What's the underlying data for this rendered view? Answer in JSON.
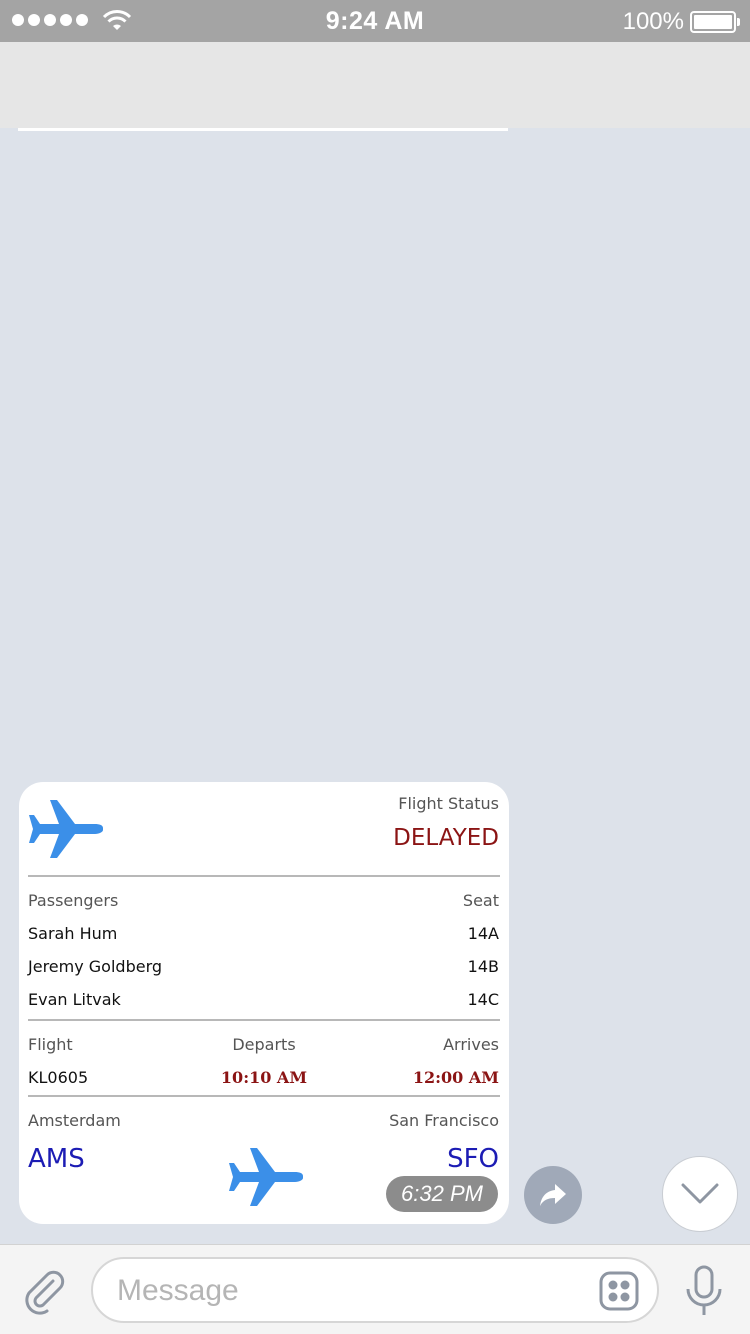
{
  "status_bar": {
    "time": "9:24 AM",
    "battery_percent": "100%",
    "battery_level": 1.0,
    "signal_bars": 5,
    "icons": [
      "signal-dots-icon",
      "wifi-icon",
      "battery-icon"
    ]
  },
  "card": {
    "status_label": "Flight Status",
    "status_value": "DELAYED",
    "passengers_header": "Passengers",
    "seat_header": "Seat",
    "passengers": [
      {
        "name": "Sarah Hum",
        "seat": "14A"
      },
      {
        "name": "Jeremy Goldberg",
        "seat": "14B"
      },
      {
        "name": "Evan Litvak",
        "seat": "14C"
      }
    ],
    "flight_header": "Flight",
    "departs_header": "Departs",
    "arrives_header": "Arrives",
    "flight_number": "KL0605",
    "departs_time": "10:10 AM",
    "arrives_time": "12:00 AM",
    "origin_city": "Amsterdam",
    "destination_city": "San Francisco",
    "origin_code": "AMS",
    "destination_code": "SFO",
    "timestamp": "6:32 PM"
  },
  "input": {
    "placeholder": "Message"
  },
  "colors": {
    "status_red": "#8b1414",
    "airport_blue": "#1c1cb4",
    "plane_blue": "#3b8fe8",
    "chat_background": "#dde2ea"
  }
}
